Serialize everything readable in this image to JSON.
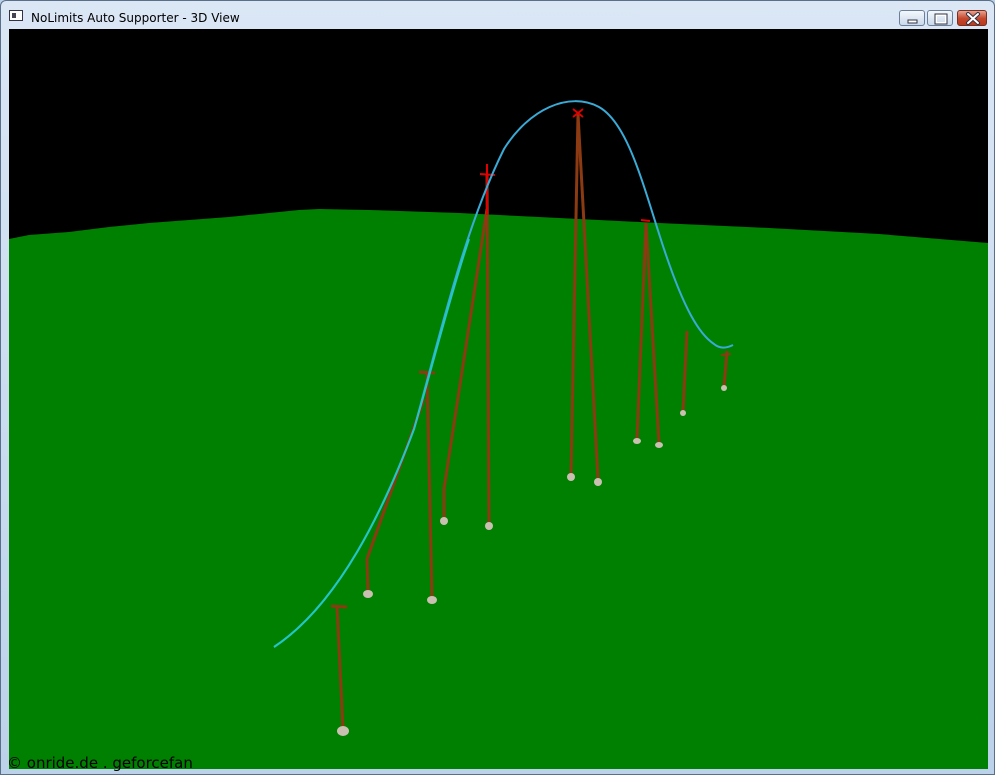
{
  "window": {
    "title": "NoLimits Auto Supporter - 3D View",
    "icon": "app-window-icon",
    "controls": [
      "minimize-icon",
      "maximize-icon",
      "close-icon"
    ]
  },
  "scene": {
    "sky_color": "#000000",
    "ground_color": "#008000",
    "track_color": "#3aaad6",
    "support_color": "#8b3a12",
    "support_top_color": "#e00000",
    "footer_color": "#c9c0b2"
  },
  "watermark": {
    "text": "© onride.de . geforcefan"
  }
}
